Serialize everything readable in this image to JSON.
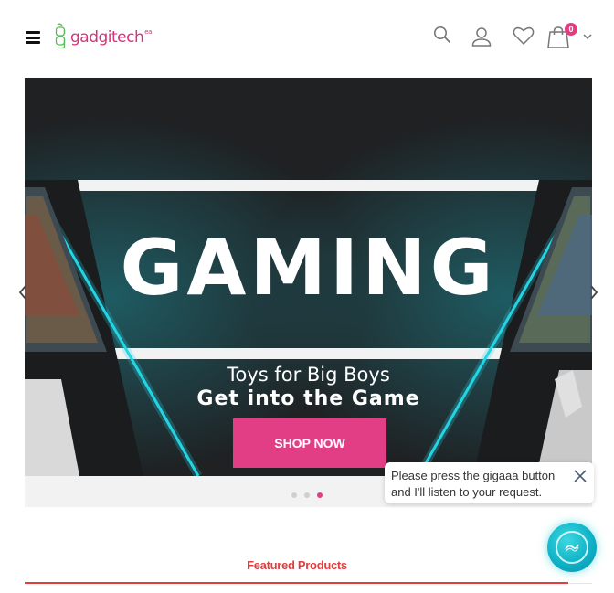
{
  "header": {
    "logo_text": "gadgitech",
    "logo_superscript": "ea",
    "cart_count": "0",
    "icons": [
      "menu-icon",
      "search-icon",
      "user-icon",
      "heart-icon",
      "cart-icon",
      "chevron-down-icon"
    ]
  },
  "slider": {
    "headline": "GAMING",
    "subtitle": "Toys for Big Boys",
    "tagline": "Get into the Game",
    "cta_label": "SHOP NOW",
    "slide_count": 3,
    "active_slide": 3
  },
  "assistant": {
    "prompt_text": "Please press the gigaaa button and I'll listen to your request."
  },
  "section": {
    "title": "Featured Products"
  },
  "colors": {
    "accent": "#e23e86",
    "section_accent": "#e23e3e",
    "logo": "#d6337c",
    "banner_bg": "#202224",
    "neon": "#1ec8d8"
  }
}
